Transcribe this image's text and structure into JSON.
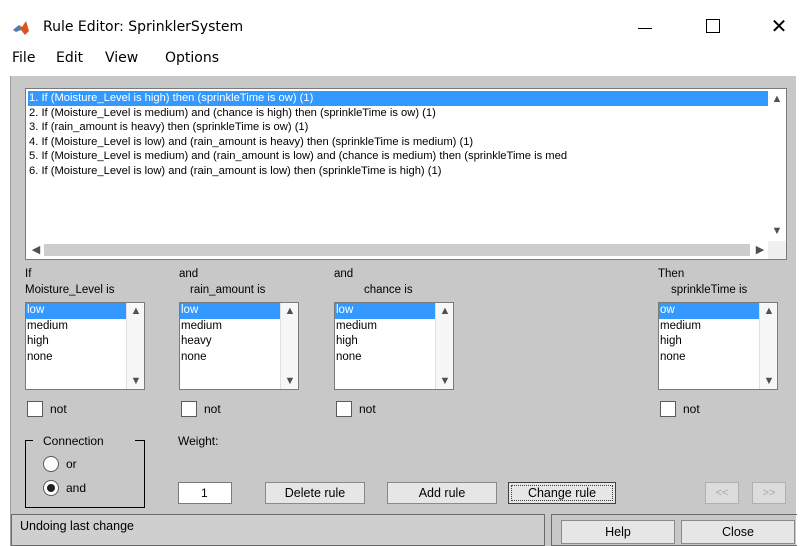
{
  "window": {
    "title": "Rule Editor: SprinklerSystem",
    "close_glyph": "✕"
  },
  "menu": [
    "File",
    "Edit",
    "View",
    "Options"
  ],
  "rules": [
    "1. If (Moisture_Level is high) then (sprinkleTime is ow) (1)",
    "2. If (Moisture_Level is medium) and (chance is high) then (sprinkleTime is ow) (1)",
    "3. If (rain_amount is heavy) then (sprinkleTime is ow) (1)",
    "4. If (Moisture_Level is low) and (rain_amount is heavy) then (sprinkleTime is medium) (1)",
    "5. If (Moisture_Level is medium) and (rain_amount is low) and (chance is medium) then (sprinkleTime is med",
    "6. If (Moisture_Level is low) and (rain_amount is low) then (sprinkleTime is high) (1)"
  ],
  "scroll_glyphs": {
    "up": "▲",
    "down": "▼",
    "left": "◀",
    "right": "▶"
  },
  "inputs": {
    "moisture": {
      "prefix": "If",
      "label": "Moisture_Level is",
      "options": [
        "low",
        "medium",
        "high",
        "none"
      ],
      "not_label": "not"
    },
    "rain": {
      "prefix": "and",
      "label": "rain_amount is",
      "options": [
        "low",
        "medium",
        "heavy",
        "none"
      ],
      "not_label": "not"
    },
    "chance": {
      "prefix": "and",
      "label": "chance is",
      "options": [
        "low",
        "medium",
        "high",
        "none"
      ],
      "not_label": "not"
    }
  },
  "output": {
    "prefix": "Then",
    "label": "sprinkleTime is",
    "options": [
      "ow",
      "medium",
      "high",
      "none"
    ],
    "not_label": "not"
  },
  "connection": {
    "title": "Connection",
    "or_label": "or",
    "and_label": "and",
    "selected": "and"
  },
  "weight": {
    "label": "Weight:",
    "value": "1"
  },
  "buttons": {
    "delete": "Delete rule",
    "add": "Add rule",
    "change": "Change rule",
    "prev": "<<",
    "next": ">>",
    "help": "Help",
    "close": "Close"
  },
  "status": "Undoing last change"
}
